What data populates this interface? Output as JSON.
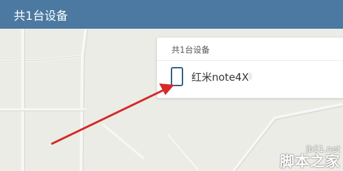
{
  "header": {
    "title": "共1台设备"
  },
  "device_panel": {
    "title": "共1台设备",
    "devices": [
      {
        "name": "红米note4X",
        "sub": "1"
      }
    ]
  },
  "watermark": {
    "url": "jb51.net",
    "name": "脚本之家"
  },
  "colors": {
    "header_bg": "#4b79a1",
    "map_bg": "#ecece7",
    "arrow": "#d32a2a",
    "phone_icon": "#2f5f86"
  }
}
